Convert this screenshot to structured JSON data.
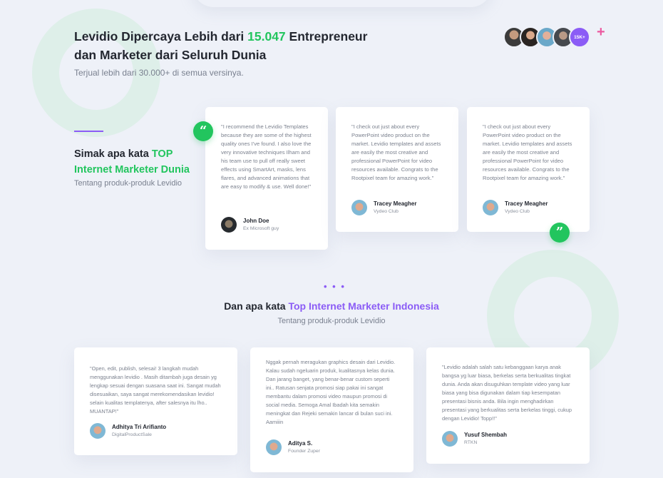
{
  "hero": {
    "title_pre": "Levidio Dipercaya Lebih dari ",
    "title_count": "15.047",
    "title_post": " Entrepreneur dan Marketer dari Seluruh Dunia",
    "subtitle": "Terjual lebih dari 30.000+ di semua versinya.",
    "avatar_count_label": "15K+"
  },
  "section1": {
    "title_pre": "Simak apa kata ",
    "title_highlight": "TOP Internet Marketer Dunia",
    "subtitle": "Tentang produk-produk Levidio",
    "testimonials": [
      {
        "quote": "\"I recommend the Levidio Templates because they are some of the highest quality ones I've found. I also love the very innovative techniques Ilham and his team use to pull off really sweet effects using SmartArt, masks, lens flares, and advanced animations that are easy to modify & use. Well done!\"",
        "name": "John Doe",
        "role": "Ex Microsoft guy"
      },
      {
        "quote": "\"I check out just about every PowerPoint video product on the market. Levidio templates and assets are easily the most creative and professional PowerPoint for video resources available. Congrats to the Rootpixel team for amazing work.\"",
        "name": "Tracey Meagher",
        "role": "Vydeo Club"
      },
      {
        "quote": "\"I check out just about every PowerPoint video product on the market. Levidio templates and assets are easily the most creative and professional PowerPoint for video resources available. Congrats to the Rootpixel team for amazing work.\"",
        "name": "Tracey Meagher",
        "role": "Vydeo Club"
      }
    ]
  },
  "section2": {
    "dots": "• • •",
    "title_pre": "Dan apa kata ",
    "title_highlight": "Top Internet Marketer Indonesia",
    "subtitle": "Tentang produk-produk Levidio",
    "testimonials": [
      {
        "quote": "\"Open, edit, publish, selesai! 3 langkah mudah menggunakan levidio . Masih ditambah juga desain yg lengkap sesuai dengan suasana saat ini. Sangat mudah disesuaikan, saya sangat merekomendasikan levidio! selain kualitas templatenya, after salesnya itu lho.. MUANTAP!\"",
        "name": "Adhitya Tri Arifianto",
        "role": "DigitalProductSale"
      },
      {
        "quote": "Nggak pernah meragukan graphics desain dari Levidio. Kalau sudah ngeluarin produk, kualitasnya kelas dunia. Dan jarang banget, yang benar-benar custom seperti ini.. Ratusan senjata promosi siap pakai ini sangat membantu dalam promosi video maupun promosi di social media. Semoga Amal Ibadah kita semakin meningkat dan Rejeki semakin lancar di bulan suci ini. Aamiiin",
        "name": "Aditya S.",
        "role": "Founder Zuper"
      },
      {
        "quote": "\"Levidio adalah salah satu kebanggaan karya anak bangsa yg luar biasa, berkelas serta berkualitas tingkat dunia. Anda akan disuguhkan template video yang luar biasa yang bisa digunakan dalam tiap kesempatan presentasi bisnis anda. Bila ingin menghadirkan presentasi yang berkualitas serta berkelas tinggi, cukup dengan Levidio! Topp!!\"",
        "name": "Yusuf Shembah",
        "role": "RTKN"
      }
    ]
  },
  "colors": {
    "green": "#22c55e",
    "purple": "#8b5cf6",
    "pink": "#ec5aa0",
    "background": "#eef1f8"
  },
  "icons": {
    "quote_open": "quote-open-icon",
    "quote_close": "quote-close-icon",
    "plus": "plus-icon"
  }
}
